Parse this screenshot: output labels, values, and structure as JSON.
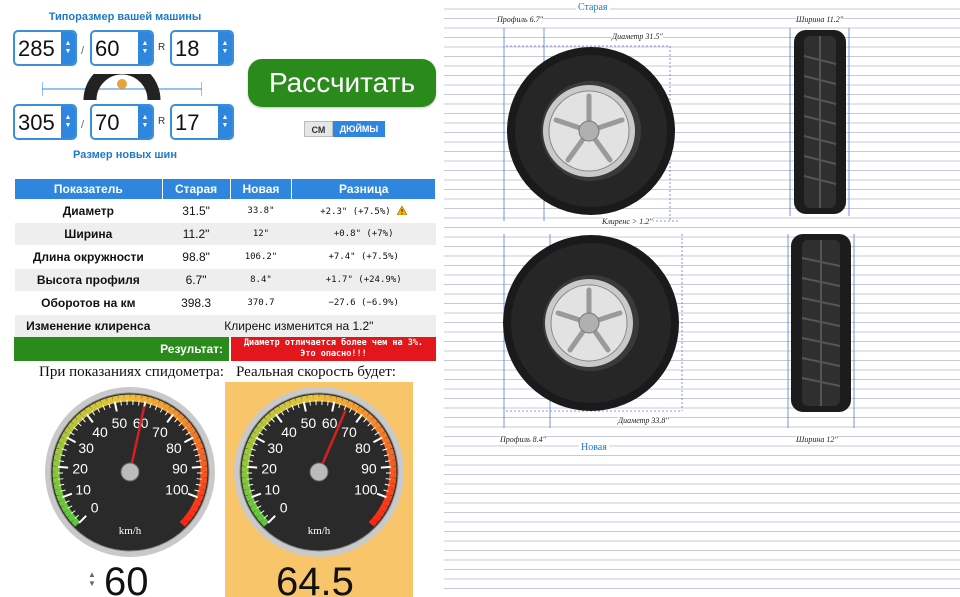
{
  "left": {
    "old_size_caption": "Типоразмер вашей машины",
    "new_size_caption": "Размер новых шин",
    "old": {
      "width": "285",
      "profile": "60",
      "rim": "18"
    },
    "new": {
      "width": "305",
      "profile": "70",
      "rim": "17"
    },
    "slash": "/",
    "r_label": "R",
    "calc_button": "Рассчитать",
    "units": {
      "cm": "СМ",
      "inch": "ДЮЙМЫ",
      "active": "ДЮЙМЫ"
    }
  },
  "table": {
    "headers": [
      "Показатель",
      "Старая",
      "Новая",
      "Разница"
    ],
    "rows": [
      {
        "label": "Диаметр",
        "old": "31.5\"",
        "new": "33.8\"",
        "diff": "+2.3\" (+7.5%)"
      },
      {
        "label": "Ширина",
        "old": "11.2\"",
        "new": "12\"",
        "diff": "+0.8\" (+7%)"
      },
      {
        "label": "Длина окружности",
        "old": "98.8\"",
        "new": "106.2\"",
        "diff": "+7.4\" (+7.5%)"
      },
      {
        "label": "Высота профиля",
        "old": "6.7\"",
        "new": "8.4\"",
        "diff": "+1.7\" (+24.9%)"
      },
      {
        "label": "Оборотов на км",
        "old": "398.3",
        "new": "370.7",
        "diff": "−27.6 (−6.9%)"
      }
    ],
    "clearance_label": "Изменение клиренса",
    "clearance_value": "Клиренс изменится на 1.2\"",
    "result_label": "Результат:",
    "result_line1": "Диаметр отличается более чем на 3%.",
    "result_line2": "Это опасно!!!"
  },
  "speed": {
    "indicated_caption": "При показаниях спидометра:",
    "real_caption": "Реальная скорость будет:",
    "unit": "km/h",
    "ticks": [
      "0",
      "10",
      "20",
      "30",
      "40",
      "50",
      "60",
      "70",
      "80",
      "90",
      "100"
    ],
    "indicated": "60",
    "real": "64.5",
    "indicated_value": 60,
    "real_value": 64.5,
    "scale_max": 110,
    "colors": {
      "highlight_bg": "#f9c56b",
      "needle": "#d42020"
    }
  },
  "diagram": {
    "old_title": "Старая",
    "new_title": "Новая",
    "old_profile": "Профиль 6.7\"",
    "old_diameter": "Диаметр 31.5\"",
    "old_width": "Ширина 11.2\"",
    "clearance": "Клиренс > 1.2\"",
    "new_profile": "Профиль 8.4\"",
    "new_diameter": "Диаметр 33.8\"",
    "new_width": "Ширина 12\""
  }
}
